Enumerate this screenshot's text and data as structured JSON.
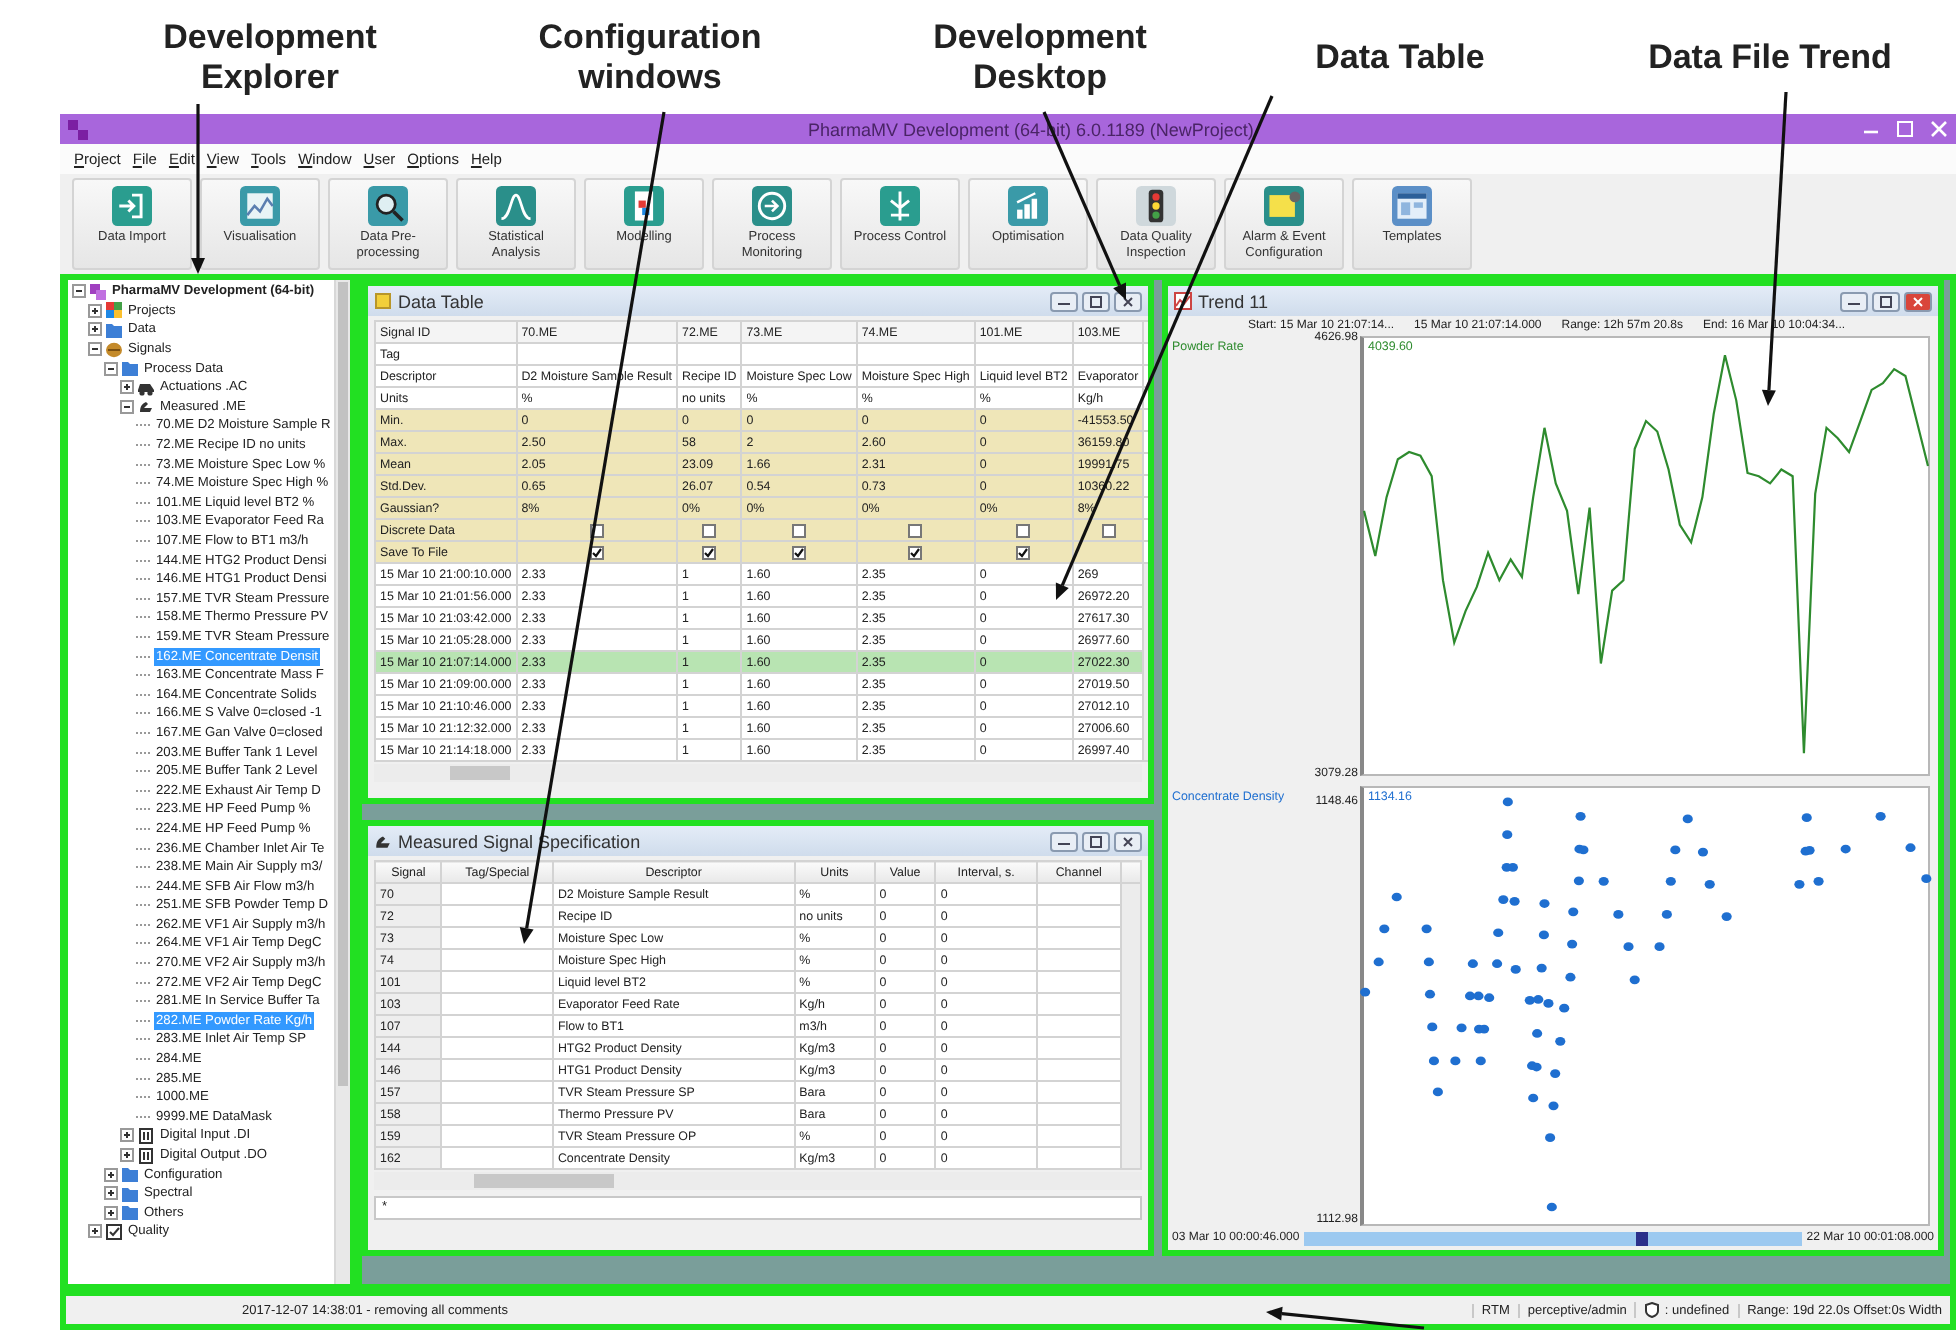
{
  "annotations": [
    {
      "label": "Development Explorer"
    },
    {
      "label": "Configuration windows"
    },
    {
      "label": "Development Desktop"
    },
    {
      "label": "Data Table"
    },
    {
      "label": "Data File Trend"
    }
  ],
  "window": {
    "title": "PharmaMV Development (64-bit) 6.0.1189 (NewProject)"
  },
  "menu": [
    "Project",
    "File",
    "Edit",
    "View",
    "Tools",
    "Window",
    "User",
    "Options",
    "Help"
  ],
  "toolbar": [
    "Data Import",
    "Visualisation",
    "Data Pre-processing",
    "Statistical Analysis",
    "Modelling",
    "Process Monitoring",
    "Process Control",
    "Optimisation",
    "Data Quality Inspection",
    "Alarm & Event Configuration",
    "Templates"
  ],
  "explorer": {
    "tree": [
      {
        "label": "PharmaMV Development (64-bit)",
        "kind": "app",
        "expanded": true,
        "selected": false,
        "children": [
          {
            "label": "Projects",
            "kind": "grid",
            "expanded": false,
            "selected": false
          },
          {
            "label": "Data",
            "kind": "folder",
            "expanded": false,
            "selected": false
          },
          {
            "label": "Signals",
            "kind": "database",
            "expanded": true,
            "selected": false,
            "children": [
              {
                "label": "Process Data",
                "kind": "folder",
                "expanded": true,
                "selected": false,
                "children": [
                  {
                    "label": "Actuations .AC",
                    "kind": "vehicle",
                    "expanded": false,
                    "selected": false
                  },
                  {
                    "label": "Measured .ME",
                    "kind": "hand",
                    "expanded": true,
                    "selected": false,
                    "children": [
                      {
                        "label": "70.ME D2 Moisture Sample R",
                        "kind": "leaf",
                        "selected": false
                      },
                      {
                        "label": "72.ME Recipe ID no units",
                        "kind": "leaf",
                        "selected": false
                      },
                      {
                        "label": "73.ME Moisture Spec Low %",
                        "kind": "leaf",
                        "selected": false
                      },
                      {
                        "label": "74.ME Moisture Spec High %",
                        "kind": "leaf",
                        "selected": false
                      },
                      {
                        "label": "101.ME Liquid level BT2 %",
                        "kind": "leaf",
                        "selected": false
                      },
                      {
                        "label": "103.ME Evaporator Feed Ra",
                        "kind": "leaf",
                        "selected": false
                      },
                      {
                        "label": "107.ME Flow to BT1 m3/h",
                        "kind": "leaf",
                        "selected": false
                      },
                      {
                        "label": "144.ME HTG2 Product Densi",
                        "kind": "leaf",
                        "selected": false
                      },
                      {
                        "label": "146.ME HTG1 Product Densi",
                        "kind": "leaf",
                        "selected": false
                      },
                      {
                        "label": "157.ME TVR Steam Pressure",
                        "kind": "leaf",
                        "selected": false
                      },
                      {
                        "label": "158.ME Thermo Pressure PV",
                        "kind": "leaf",
                        "selected": false
                      },
                      {
                        "label": "159.ME TVR Steam Pressure",
                        "kind": "leaf",
                        "selected": false
                      },
                      {
                        "label": "162.ME Concentrate Densit",
                        "kind": "leaf",
                        "selected": true
                      },
                      {
                        "label": "163.ME Concentrate Mass F",
                        "kind": "leaf",
                        "selected": false
                      },
                      {
                        "label": "164.ME Concentrate Solids",
                        "kind": "leaf",
                        "selected": false
                      },
                      {
                        "label": "166.ME S Valve 0=closed -1",
                        "kind": "leaf",
                        "selected": false
                      },
                      {
                        "label": "167.ME Gan Valve 0=closed",
                        "kind": "leaf",
                        "selected": false
                      },
                      {
                        "label": "203.ME Buffer Tank 1 Level",
                        "kind": "leaf",
                        "selected": false
                      },
                      {
                        "label": "205.ME Buffer Tank 2 Level",
                        "kind": "leaf",
                        "selected": false
                      },
                      {
                        "label": "222.ME Exhaust Air Temp D",
                        "kind": "leaf",
                        "selected": false
                      },
                      {
                        "label": "223.ME HP Feed Pump %",
                        "kind": "leaf",
                        "selected": false
                      },
                      {
                        "label": "224.ME HP Feed Pump %",
                        "kind": "leaf",
                        "selected": false
                      },
                      {
                        "label": "236.ME Chamber Inlet Air Te",
                        "kind": "leaf",
                        "selected": false
                      },
                      {
                        "label": "238.ME Main Air Supply m3/",
                        "kind": "leaf",
                        "selected": false
                      },
                      {
                        "label": "244.ME SFB Air Flow m3/h",
                        "kind": "leaf",
                        "selected": false
                      },
                      {
                        "label": "251.ME SFB Powder Temp D",
                        "kind": "leaf",
                        "selected": false
                      },
                      {
                        "label": "262.ME VF1 Air Supply m3/h",
                        "kind": "leaf",
                        "selected": false
                      },
                      {
                        "label": "264.ME VF1 Air Temp DegC",
                        "kind": "leaf",
                        "selected": false
                      },
                      {
                        "label": "270.ME VF2 Air Supply m3/h",
                        "kind": "leaf",
                        "selected": false
                      },
                      {
                        "label": "272.ME VF2 Air Temp DegC",
                        "kind": "leaf",
                        "selected": false
                      },
                      {
                        "label": "281.ME In Service Buffer Ta",
                        "kind": "leaf",
                        "selected": false
                      },
                      {
                        "label": "282.ME Powder Rate Kg/h",
                        "kind": "leaf",
                        "selected": true
                      },
                      {
                        "label": "283.ME Inlet Air Temp SP",
                        "kind": "leaf",
                        "selected": false
                      },
                      {
                        "label": "284.ME",
                        "kind": "leaf",
                        "selected": false
                      },
                      {
                        "label": "285.ME",
                        "kind": "leaf",
                        "selected": false
                      },
                      {
                        "label": "1000.ME",
                        "kind": "leaf",
                        "selected": false
                      },
                      {
                        "label": "9999.ME DataMask",
                        "kind": "leaf",
                        "selected": false
                      }
                    ]
                  },
                  {
                    "label": "Digital Input .DI",
                    "kind": "chip",
                    "expanded": false,
                    "selected": false
                  },
                  {
                    "label": "Digital Output .DO",
                    "kind": "chip",
                    "expanded": false,
                    "selected": false
                  }
                ]
              },
              {
                "label": "Configuration",
                "kind": "folder",
                "expanded": false,
                "selected": false
              },
              {
                "label": "Spectral",
                "kind": "folder",
                "expanded": false,
                "selected": false
              },
              {
                "label": "Others",
                "kind": "folder",
                "expanded": false,
                "selected": false
              }
            ]
          },
          {
            "label": "Quality",
            "kind": "check",
            "expanded": false,
            "selected": false
          }
        ]
      }
    ]
  },
  "data_table": {
    "title": "Data Table",
    "columns": [
      "Signal ID",
      "70.ME",
      "72.ME",
      "73.ME",
      "74.ME",
      "101.ME",
      "103.ME"
    ],
    "rows": [
      {
        "kind": "blank",
        "selected": false,
        "cells": [
          "Tag"
        ]
      },
      {
        "kind": "text",
        "selected": false,
        "cells": [
          "Descriptor",
          "D2 Moisture Sample Result",
          "Recipe ID",
          "Moisture Spec Low",
          "Moisture Spec High",
          "Liquid level BT2",
          "Evaporator"
        ]
      },
      {
        "kind": "text",
        "selected": false,
        "cells": [
          "Units",
          "%",
          "no units",
          "%",
          "%",
          "%",
          "Kg/h"
        ]
      },
      {
        "kind": "stat",
        "selected": false,
        "cells": [
          "Min.",
          "0",
          "0",
          "0",
          "0",
          "0",
          "-41553.50"
        ]
      },
      {
        "kind": "stat",
        "selected": false,
        "cells": [
          "Max.",
          "2.50",
          "58",
          "2",
          "2.60",
          "0",
          "36159.80"
        ]
      },
      {
        "kind": "stat",
        "selected": false,
        "cells": [
          "Mean",
          "2.05",
          "23.09",
          "1.66",
          "2.31",
          "0",
          "19991.75"
        ]
      },
      {
        "kind": "stat",
        "selected": false,
        "cells": [
          "Std.Dev.",
          "0.65",
          "26.07",
          "0.54",
          "0.73",
          "0",
          "10360.22"
        ]
      },
      {
        "kind": "stat",
        "selected": false,
        "cells": [
          "Gaussian?",
          "8%",
          "0%",
          "0%",
          "0%",
          "0%",
          "8%"
        ]
      },
      {
        "kind": "check",
        "selected": false,
        "cells": [
          "Discrete Data",
          {
            "checked": false
          },
          {
            "checked": false
          },
          {
            "checked": false
          },
          {
            "checked": false
          },
          {
            "checked": false
          },
          {
            "checked": false
          }
        ]
      },
      {
        "kind": "check",
        "selected": false,
        "cells": [
          "Save To File",
          {
            "checked": true
          },
          {
            "checked": true
          },
          {
            "checked": true
          },
          {
            "checked": true
          },
          {
            "checked": true
          }
        ]
      },
      {
        "kind": "data",
        "selected": false,
        "cells": [
          "15 Mar 10 21:00:10.000",
          "2.33",
          "1",
          "1.60",
          "2.35",
          "0",
          "269"
        ]
      },
      {
        "kind": "data",
        "selected": false,
        "cells": [
          "15 Mar 10 21:01:56.000",
          "2.33",
          "1",
          "1.60",
          "2.35",
          "0",
          "26972.20"
        ]
      },
      {
        "kind": "data",
        "selected": false,
        "cells": [
          "15 Mar 10 21:03:42.000",
          "2.33",
          "1",
          "1.60",
          "2.35",
          "0",
          "27617.30"
        ]
      },
      {
        "kind": "data",
        "selected": false,
        "cells": [
          "15 Mar 10 21:05:28.000",
          "2.33",
          "1",
          "1.60",
          "2.35",
          "0",
          "26977.60"
        ]
      },
      {
        "kind": "data",
        "selected": true,
        "cells": [
          "15 Mar 10 21:07:14.000",
          "2.33",
          "1",
          "1.60",
          "2.35",
          "0",
          "27022.30"
        ]
      },
      {
        "kind": "data",
        "selected": false,
        "cells": [
          "15 Mar 10 21:09:00.000",
          "2.33",
          "1",
          "1.60",
          "2.35",
          "0",
          "27019.50"
        ]
      },
      {
        "kind": "data",
        "selected": false,
        "cells": [
          "15 Mar 10 21:10:46.000",
          "2.33",
          "1",
          "1.60",
          "2.35",
          "0",
          "27012.10"
        ]
      },
      {
        "kind": "data",
        "selected": false,
        "cells": [
          "15 Mar 10 21:12:32.000",
          "2.33",
          "1",
          "1.60",
          "2.35",
          "0",
          "27006.60"
        ]
      },
      {
        "kind": "data",
        "selected": false,
        "cells": [
          "15 Mar 10 21:14:18.000",
          "2.33",
          "1",
          "1.60",
          "2.35",
          "0",
          "26997.40"
        ]
      }
    ]
  },
  "signal_spec": {
    "title": "Measured Signal Specification",
    "columns": [
      "Signal",
      "Tag/Special",
      "Descriptor",
      "Units",
      "Value",
      "Interval, s.",
      "Channel"
    ],
    "rows": [
      [
        "70",
        "",
        "D2 Moisture Sample Result",
        "%",
        "0",
        "0"
      ],
      [
        "72",
        "",
        "Recipe ID",
        "no units",
        "0",
        "0"
      ],
      [
        "73",
        "",
        "Moisture Spec Low",
        "%",
        "0",
        "0"
      ],
      [
        "74",
        "",
        "Moisture Spec High",
        "%",
        "0",
        "0"
      ],
      [
        "101",
        "",
        "Liquid level BT2",
        "%",
        "0",
        "0"
      ],
      [
        "103",
        "",
        "Evaporator Feed Rate",
        "Kg/h",
        "0",
        "0"
      ],
      [
        "107",
        "",
        "Flow to BT1",
        "m3/h",
        "0",
        "0"
      ],
      [
        "144",
        "",
        "HTG2 Product Density",
        "Kg/m3",
        "0",
        "0"
      ],
      [
        "146",
        "",
        "HTG1 Product Density",
        "Kg/m3",
        "0",
        "0"
      ],
      [
        "157",
        "",
        "TVR Steam Pressure SP",
        "Bara",
        "0",
        "0"
      ],
      [
        "158",
        "",
        "Thermo Pressure PV",
        "Bara",
        "0",
        "0"
      ],
      [
        "159",
        "",
        "TVR Steam Pressure OP",
        "%",
        "0",
        "0"
      ],
      [
        "162",
        "",
        "Concentrate Density",
        "Kg/m3",
        "0",
        "0"
      ]
    ],
    "filter": "*"
  },
  "trend": {
    "title": "Trend 11",
    "header": [
      "Start: 15 Mar 10 21:07:14...",
      "15 Mar 10 21:07:14.000",
      "Range: 12h 57m 20.8s",
      "End: 16 Mar 10 10:04:34..."
    ],
    "plots": [
      {
        "kind": "chart",
        "current": "4039.60",
        "chart_data": {
          "type": "line",
          "ylim": [
            3079.28,
            4626.98
          ],
          "yticks": [
            {
              "value": 4626.98,
              "label": "4626.98"
            },
            {
              "value": 3079.28,
              "label": "3079.28"
            }
          ],
          "series": [
            {
              "name": "Powder Rate",
              "color": "#2e8b2e",
              "values": [
                4013,
                3853,
                4062,
                4197,
                4222,
                4209,
                4136,
                3767,
                3546,
                3657,
                3743,
                3865,
                3767,
                3841,
                3779,
                4062,
                4308,
                4111,
                4013,
                3718,
                4025,
                3472,
                3730,
                3767,
                4234,
                4332,
                4295,
                4160,
                3964,
                3902,
                4062,
                4357,
                4566,
                4406,
                4148,
                4136,
                4111,
                4160,
                4136,
                3153,
                4074,
                4308,
                4271,
                4222,
                4332,
                4443,
                4467,
                4516,
                4492,
                4332,
                4173
              ]
            }
          ]
        }
      },
      {
        "kind": "scatter",
        "name": "Concentrate Density",
        "color": "#1f6fd0",
        "current": "1134.16",
        "ticks": [
          "1148.46",
          "1112.98"
        ]
      }
    ],
    "range": {
      "start": "03 Mar 10 00:00:46.000",
      "end": "22 Mar 10 00:01:08.000",
      "level": 0.68
    }
  },
  "status_bar": {
    "message": "2017-12-07 14:38:01 - removing all comments",
    "items": [
      {
        "label": "RTM",
        "kind": "text"
      },
      {
        "label": "perceptive/admin",
        "kind": "text"
      },
      {
        "label": ": undefined",
        "kind": "icon"
      },
      {
        "label": "Range: 19d 22.0s Offset:0s Width",
        "kind": "text"
      }
    ]
  }
}
